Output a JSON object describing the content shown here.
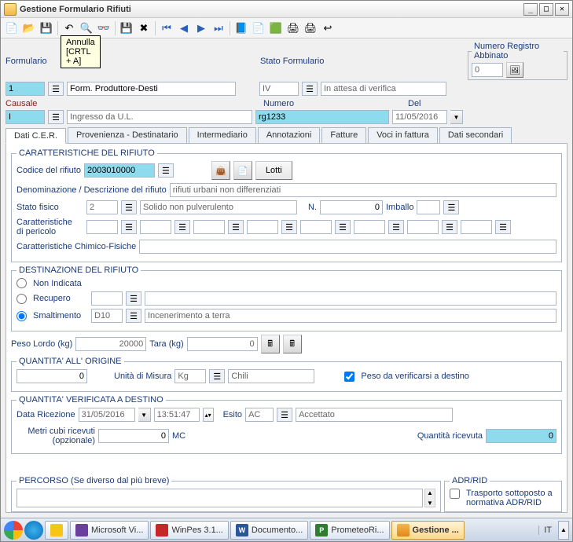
{
  "window": {
    "title": "Gestione Formulario Rifiuti"
  },
  "tooltip": {
    "line1": "Annulla",
    "line2": "[CRTL + A]"
  },
  "header": {
    "formulario_label": "Formulario",
    "formulario_no": "1",
    "formulario_desc": "Form. Produttore-Desti",
    "stato_label": "Stato Formulario",
    "stato_code": "IV",
    "stato_desc": "In attesa di verifica",
    "numero_reg_label": "Numero Registro Abbinato",
    "numero_reg_val": "0",
    "causale_label": "Causale",
    "causale_code": "I",
    "causale_desc": "Ingresso da U.L.",
    "numero_label": "Numero",
    "numero_val": "rg1233",
    "del_label": "Del",
    "del_val": "11/05/2016"
  },
  "tabs": [
    "Dati C.E.R.",
    "Provenienza - Destinatario",
    "Intermediario",
    "Annotazioni",
    "Fatture",
    "Voci in fattura",
    "Dati secondari"
  ],
  "car": {
    "legend": "CARATTERISTICHE DEL RIFIUTO",
    "codice_label": "Codice del rifiuto",
    "codice_val": "2003010000",
    "lotti_label": "Lotti",
    "denom_label": "Denominazione / Descrizione del rifiuto",
    "denom_val": "rifiuti urbani non differenziati",
    "stato_fisico_label": "Stato fisico",
    "stato_fisico_code": "2",
    "stato_fisico_desc": "Solido non pulverulento",
    "n_label": "N.",
    "n_val": "0",
    "imballo_label": "Imballo",
    "imballo_val": "",
    "car_pericolo_label": "Caratteristiche\ndi pericolo",
    "car_chim_label": "Caratteristiche Chimico-Fisiche",
    "car_chim_val": ""
  },
  "dest": {
    "legend": "DESTINAZIONE DEL RIFIUTO",
    "non_indicata": "Non Indicata",
    "recupero": "Recupero",
    "recupero_code": "",
    "recupero_desc": "",
    "smaltimento": "Smaltimento",
    "smaltimento_code": "D10",
    "smaltimento_desc": "Incenerimento a terra"
  },
  "peso": {
    "peso_lordo_label": "Peso Lordo (kg)",
    "peso_lordo_val": "20000",
    "tara_label": "Tara (kg)",
    "tara_val": "0"
  },
  "qorig": {
    "legend": "QUANTITA'  ALL' ORIGINE",
    "qty_val": "0",
    "um_label": "Unità di Misura",
    "um_code": "Kg",
    "um_desc": "Chili",
    "check_label": "Peso da verificarsi a destino"
  },
  "qdest": {
    "legend": "QUANTITA' VERIFICATA A DESTINO",
    "data_ric_label": "Data Ricezione",
    "data_ric_val": "31/05/2016",
    "time_val": "13:51:47",
    "esito_label": "Esito",
    "esito_code": "AC",
    "esito_desc": "Accettato",
    "mc_label": "Metri cubi ricevuti\n(opzionale)",
    "mc_val": "0",
    "mc_unit": "MC",
    "qric_label": "Quantità ricevuta",
    "qric_val": "0"
  },
  "percorso": {
    "legend": "PERCORSO (Se diverso dal più breve)"
  },
  "adr": {
    "legend": "ADR/RID",
    "check_label": "Trasporto sottoposto a\nnormativa ADR/RID"
  },
  "taskbar": {
    "items": [
      "Microsoft Vi...",
      "WinPes 3.1...",
      "Documento...",
      "PrometeoRi...",
      "Gestione ..."
    ],
    "lang": "IT"
  }
}
